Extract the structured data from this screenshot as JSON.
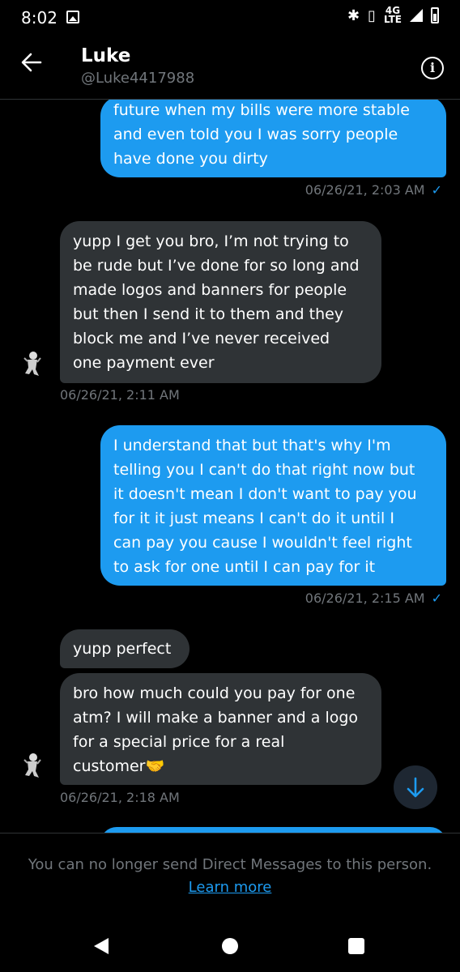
{
  "status": {
    "time": "8:02",
    "network": "4G",
    "network_sub": "LTE"
  },
  "header": {
    "name": "Luke",
    "handle": "@Luke4417988"
  },
  "messages": [
    {
      "dir": "out",
      "lines": [
        "future when my bills were more stable",
        "and even told you I was sorry people",
        "have done you dirty"
      ],
      "stamp": "06/26/21, 2:03 AM",
      "read": true
    },
    {
      "dir": "in",
      "lines": [
        "yupp I get you bro, I’m not trying to",
        "be rude but I’ve done for so long and",
        "made logos and banners for people",
        "but then I send it to them and they",
        "block me and I’ve never received",
        "one payment ever"
      ],
      "stamp": "06/26/21, 2:11 AM"
    },
    {
      "dir": "out",
      "lines": [
        "I understand that but that's why I'm",
        "telling you I can't do that right now but",
        "it doesn't mean I don't want to pay you",
        "for it it just means I can't do it until I",
        "can pay you cause I wouldn't feel right",
        "to ask for one until I can pay for it"
      ],
      "stamp": "06/26/21, 2:15 AM",
      "read": true
    },
    {
      "dir": "in",
      "lines": [
        "yupp perfect"
      ]
    },
    {
      "dir": "in",
      "lines": [
        "bro how much could you pay for one",
        "atm? I will make a banner and a logo",
        "for a special price for a real",
        "customer🤝"
      ],
      "stamp": "06/26/21, 2:18 AM"
    }
  ],
  "footer": {
    "message": "You can no longer send Direct Messages to this person.",
    "link": "Learn more"
  }
}
